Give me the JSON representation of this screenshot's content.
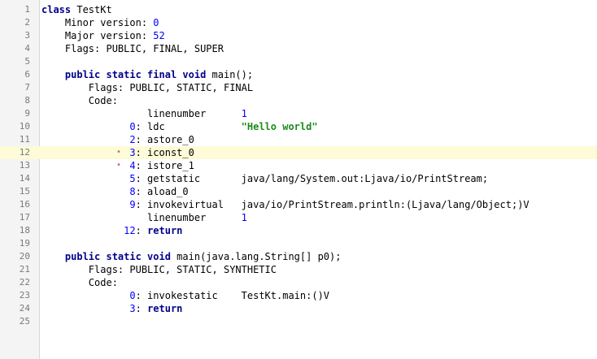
{
  "editor": {
    "colors": {
      "keyword": "#00008b",
      "number": "#0000ff",
      "string": "#1a8c1a",
      "current_line": "#fdfbd8",
      "gutter": "#f4f4f4"
    },
    "current_line": 12,
    "lines": [
      {
        "n": "1",
        "tokens": [
          {
            "t": "kw",
            "v": "class"
          },
          {
            "t": "plain",
            "v": " TestKt"
          }
        ]
      },
      {
        "n": "2",
        "tokens": [
          {
            "t": "plain",
            "v": "    Minor version: "
          },
          {
            "t": "num",
            "v": "0"
          }
        ]
      },
      {
        "n": "3",
        "tokens": [
          {
            "t": "plain",
            "v": "    Major version: "
          },
          {
            "t": "num",
            "v": "52"
          }
        ]
      },
      {
        "n": "4",
        "tokens": [
          {
            "t": "plain",
            "v": "    Flags: PUBLIC, FINAL, SUPER"
          }
        ]
      },
      {
        "n": "5",
        "tokens": []
      },
      {
        "n": "6",
        "tokens": [
          {
            "t": "plain",
            "v": "    "
          },
          {
            "t": "kw",
            "v": "public static final void"
          },
          {
            "t": "plain",
            "v": " main();"
          }
        ]
      },
      {
        "n": "7",
        "tokens": [
          {
            "t": "plain",
            "v": "        Flags: PUBLIC, STATIC, FINAL"
          }
        ]
      },
      {
        "n": "8",
        "tokens": [
          {
            "t": "plain",
            "v": "        Code:"
          }
        ]
      },
      {
        "n": "9",
        "tokens": [
          {
            "t": "plain",
            "v": "                  linenumber      "
          },
          {
            "t": "num",
            "v": "1"
          }
        ]
      },
      {
        "n": "10",
        "tokens": [
          {
            "t": "plain",
            "v": "               "
          },
          {
            "t": "num",
            "v": "0"
          },
          {
            "t": "plain",
            "v": ": ldc             "
          },
          {
            "t": "str",
            "v": "\"Hello world\""
          }
        ]
      },
      {
        "n": "11",
        "tokens": [
          {
            "t": "plain",
            "v": "               "
          },
          {
            "t": "num",
            "v": "2"
          },
          {
            "t": "plain",
            "v": ": astore_0"
          }
        ]
      },
      {
        "n": "12",
        "marker": "•",
        "tokens": [
          {
            "t": "plain",
            "v": "               "
          },
          {
            "t": "num",
            "v": "3"
          },
          {
            "t": "plain",
            "v": ": iconst_0"
          }
        ]
      },
      {
        "n": "13",
        "marker": "•",
        "tokens": [
          {
            "t": "plain",
            "v": "               "
          },
          {
            "t": "num",
            "v": "4"
          },
          {
            "t": "plain",
            "v": ": istore_1"
          }
        ]
      },
      {
        "n": "14",
        "tokens": [
          {
            "t": "plain",
            "v": "               "
          },
          {
            "t": "num",
            "v": "5"
          },
          {
            "t": "plain",
            "v": ": getstatic       java/lang/System.out:Ljava/io/PrintStream;"
          }
        ]
      },
      {
        "n": "15",
        "tokens": [
          {
            "t": "plain",
            "v": "               "
          },
          {
            "t": "num",
            "v": "8"
          },
          {
            "t": "plain",
            "v": ": aload_0"
          }
        ]
      },
      {
        "n": "16",
        "tokens": [
          {
            "t": "plain",
            "v": "               "
          },
          {
            "t": "num",
            "v": "9"
          },
          {
            "t": "plain",
            "v": ": invokevirtual   java/io/PrintStream.println:(Ljava/lang/Object;)V"
          }
        ]
      },
      {
        "n": "17",
        "tokens": [
          {
            "t": "plain",
            "v": "                  linenumber      "
          },
          {
            "t": "num",
            "v": "1"
          }
        ]
      },
      {
        "n": "18",
        "tokens": [
          {
            "t": "plain",
            "v": "              "
          },
          {
            "t": "num",
            "v": "12"
          },
          {
            "t": "plain",
            "v": ": "
          },
          {
            "t": "kw",
            "v": "return"
          }
        ]
      },
      {
        "n": "19",
        "tokens": []
      },
      {
        "n": "20",
        "tokens": [
          {
            "t": "plain",
            "v": "    "
          },
          {
            "t": "kw",
            "v": "public static void"
          },
          {
            "t": "plain",
            "v": " main(java.lang.String[] p0);"
          }
        ]
      },
      {
        "n": "21",
        "tokens": [
          {
            "t": "plain",
            "v": "        Flags: PUBLIC, STATIC, SYNTHETIC"
          }
        ]
      },
      {
        "n": "22",
        "tokens": [
          {
            "t": "plain",
            "v": "        Code:"
          }
        ]
      },
      {
        "n": "23",
        "tokens": [
          {
            "t": "plain",
            "v": "               "
          },
          {
            "t": "num",
            "v": "0"
          },
          {
            "t": "plain",
            "v": ": invokestatic    TestKt.main:()V"
          }
        ]
      },
      {
        "n": "24",
        "tokens": [
          {
            "t": "plain",
            "v": "               "
          },
          {
            "t": "num",
            "v": "3"
          },
          {
            "t": "plain",
            "v": ": "
          },
          {
            "t": "kw",
            "v": "return"
          }
        ]
      },
      {
        "n": "25",
        "tokens": []
      }
    ]
  }
}
